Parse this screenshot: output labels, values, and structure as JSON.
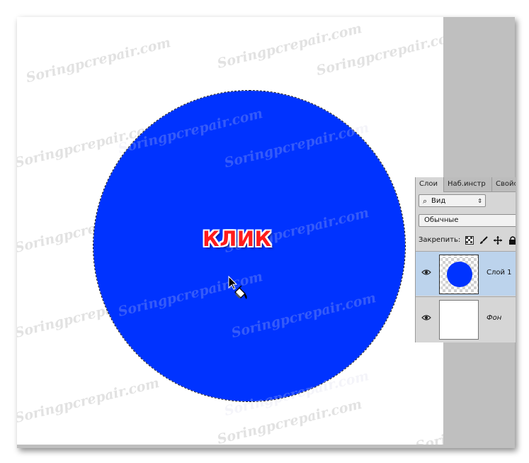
{
  "canvas": {
    "shape_color": "#0033ff",
    "click_label": "КЛИК",
    "watermark_text": "Soringpcrepair.com"
  },
  "layers_panel": {
    "tabs": [
      {
        "label": "Слои",
        "active": true
      },
      {
        "label": "Наб.инстр",
        "active": false
      },
      {
        "label": "Свойс",
        "active": false
      }
    ],
    "filter": {
      "icon": "search-icon",
      "value": "Вид"
    },
    "blend_mode": "Обычные",
    "lock_label": "Закрепить:",
    "layers": [
      {
        "name": "Слой 1",
        "selected": true,
        "visible": true
      },
      {
        "name": "Фон",
        "selected": false,
        "visible": true
      }
    ]
  }
}
